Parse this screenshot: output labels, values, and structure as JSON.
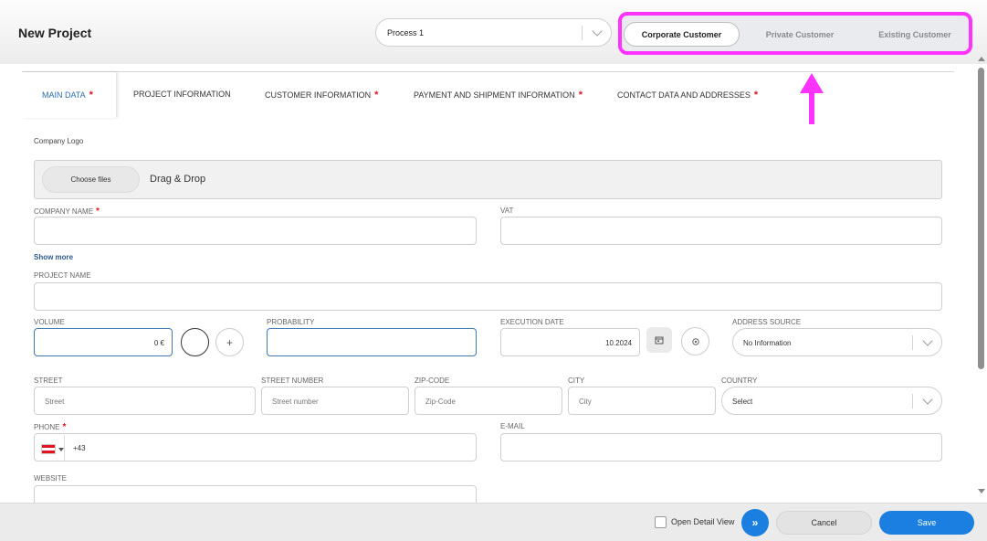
{
  "header": {
    "title": "New Project",
    "process_select": {
      "value": "Process 1"
    },
    "customer_types": [
      {
        "label": "Corporate Customer",
        "active": true
      },
      {
        "label": "Private Customer",
        "active": false
      },
      {
        "label": "Existing Customer",
        "active": false
      }
    ],
    "highlight_color": "#ff33ff"
  },
  "tabs": [
    {
      "label": "MAIN DATA",
      "required": "*",
      "active": true
    },
    {
      "label": "PROJECT INFORMATION",
      "required": "",
      "active": false
    },
    {
      "label": "CUSTOMER INFORMATION",
      "required": "*",
      "active": false
    },
    {
      "label": "PAYMENT AND SHIPMENT INFORMATION",
      "required": "*",
      "active": false
    },
    {
      "label": "CONTACT DATA AND ADDRESSES",
      "required": "*",
      "active": false
    }
  ],
  "form": {
    "company_logo": {
      "label": "Company Logo",
      "choose_files": "Choose files",
      "drag_drop": "Drag & Drop"
    },
    "company_name": {
      "label": "COMPANY NAME",
      "required": "*"
    },
    "vat": {
      "label": "VAT"
    },
    "show_more": "Show more",
    "project_name": {
      "label": "PROJECT NAME"
    },
    "volume": {
      "label": "VOLUME",
      "value": "0 €"
    },
    "probability": {
      "label": "PROBABILITY"
    },
    "execution_date": {
      "label": "EXECUTION DATE",
      "value": "10.2024"
    },
    "address_source": {
      "label": "ADDRESS SOURCE",
      "value": "No Information"
    },
    "street": {
      "label": "STREET",
      "placeholder": "Street"
    },
    "street_number": {
      "label": "STREET NUMBER",
      "placeholder": "Street number"
    },
    "zip_code": {
      "label": "ZIP-CODE",
      "placeholder": "Zip-Code"
    },
    "city": {
      "label": "CITY",
      "placeholder": "City"
    },
    "country": {
      "label": "COUNTRY",
      "value": "Select"
    },
    "phone": {
      "label": "PHONE",
      "required": "*",
      "value": "+43"
    },
    "email": {
      "label": "E-MAIL"
    },
    "website": {
      "label": "WEBSITE"
    }
  },
  "footer": {
    "open_detail_view": "Open Detail View",
    "cancel": "Cancel",
    "save": "Save",
    "accent_color": "#1a7fe0"
  }
}
